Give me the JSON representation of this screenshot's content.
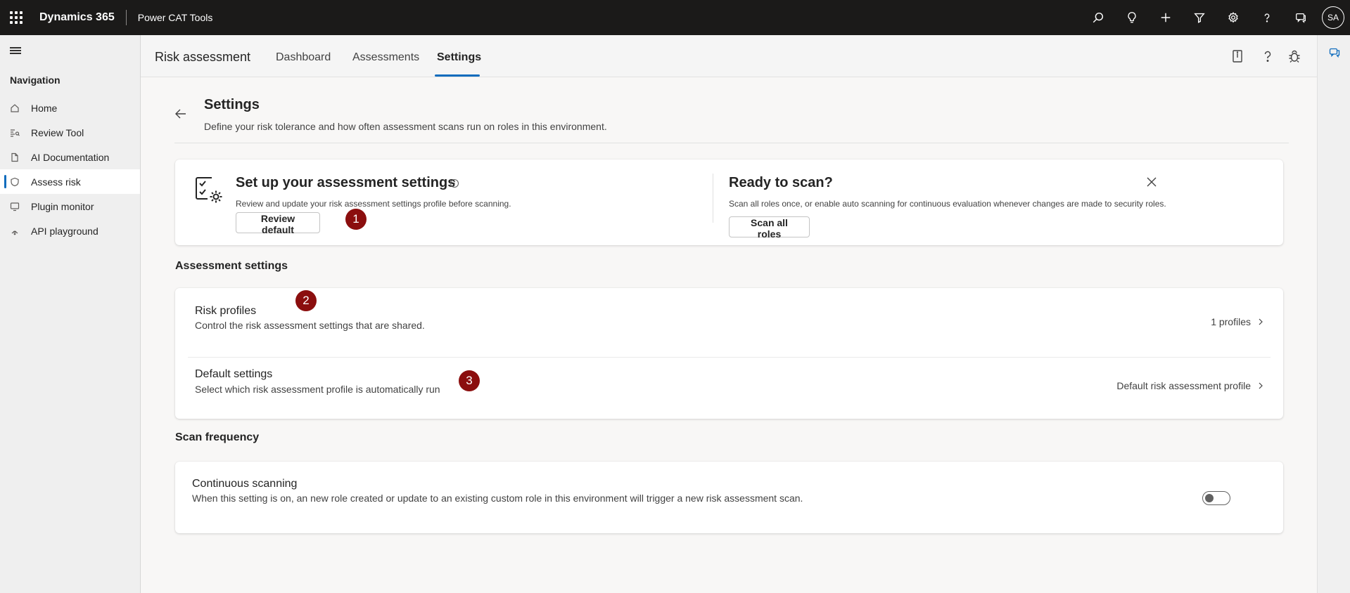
{
  "topbar": {
    "brand": "Dynamics 365",
    "app_name": "Power CAT Tools",
    "icons": [
      "search-icon",
      "lightbulb-icon",
      "plus-icon",
      "filter-icon",
      "gear-icon",
      "help-icon",
      "chat-icon"
    ],
    "avatar_initials": "SA"
  },
  "nav": {
    "title": "Navigation",
    "items": [
      {
        "label": "Home",
        "icon": "home-icon"
      },
      {
        "label": "Review Tool",
        "icon": "review-icon"
      },
      {
        "label": "AI Documentation",
        "icon": "document-icon"
      },
      {
        "label": "Assess risk",
        "icon": "shield-icon",
        "active": true
      },
      {
        "label": "Plugin monitor",
        "icon": "monitor-icon"
      },
      {
        "label": "API playground",
        "icon": "api-icon"
      }
    ]
  },
  "header": {
    "title": "Risk assessment",
    "tabs": [
      {
        "label": "Dashboard"
      },
      {
        "label": "Assessments"
      },
      {
        "label": "Settings",
        "active": true
      }
    ]
  },
  "page": {
    "title": "Settings",
    "description": "Define your risk tolerance and how often assessment scans run on roles in this environment."
  },
  "setup_card": {
    "title": "Set up your assessment settings",
    "description": "Review and update your risk assessment settings profile before scanning.",
    "button": "Review default",
    "ready_title": "Ready to scan?",
    "ready_description": "Scan all roles once, or enable auto scanning for continuous evaluation whenever changes are made to security roles.",
    "scan_button": "Scan all roles"
  },
  "assessment_settings": {
    "label": "Assessment settings",
    "rows": [
      {
        "title": "Risk profiles",
        "description": "Control the risk assessment settings that are shared.",
        "value": "1 profiles"
      },
      {
        "title": "Default settings",
        "description": "Select which risk assessment profile is automatically run",
        "value": "Default risk assessment profile"
      }
    ]
  },
  "scan_frequency": {
    "label": "Scan frequency",
    "title": "Continuous scanning",
    "description": "When this setting is on, an new role created or update to an existing custom role in this environment will trigger a new risk assessment scan.",
    "enabled": false
  },
  "markers": [
    "1",
    "2",
    "3"
  ],
  "colors": {
    "accent": "#0f6cbd",
    "marker": "#8b0e0e",
    "topbar": "#1b1a19"
  }
}
